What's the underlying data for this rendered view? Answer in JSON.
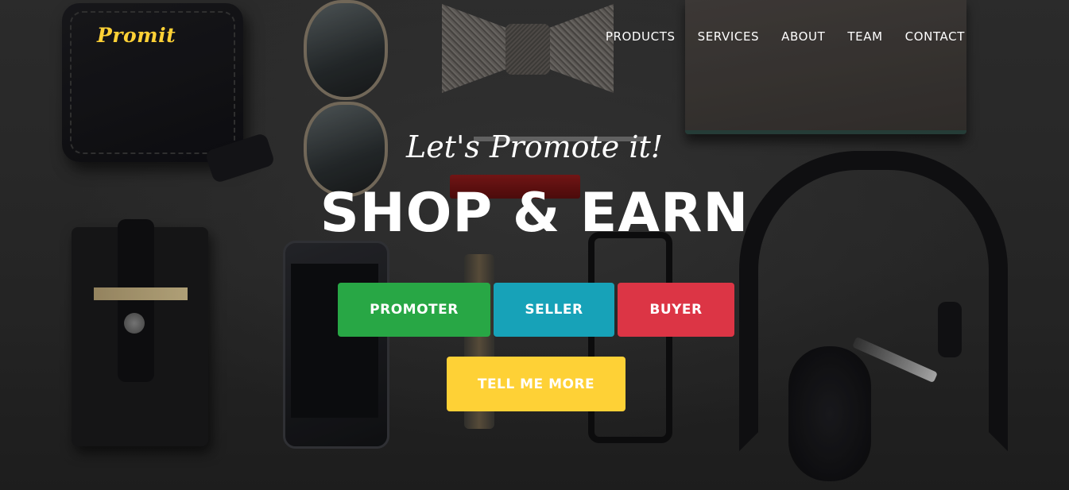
{
  "brand": {
    "name": "Promit"
  },
  "nav": {
    "items": [
      "PRODUCTS",
      "SERVICES",
      "ABOUT",
      "TEAM",
      "CONTACT"
    ]
  },
  "hero": {
    "subheading": "Let's Promote it!",
    "heading": "SHOP & EARN",
    "buttons": {
      "promoter": "PROMOTER",
      "seller": "SELLER",
      "buyer": "BUYER",
      "more": "TELL ME MORE"
    }
  },
  "colors": {
    "brand_yellow": "#fed136",
    "promoter_green": "#28a745",
    "seller_teal": "#17a2b8",
    "buyer_red": "#dc3545"
  }
}
